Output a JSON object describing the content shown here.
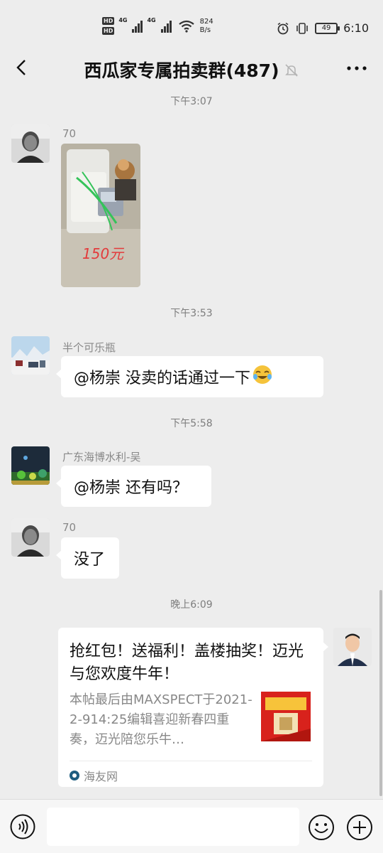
{
  "status_bar": {
    "hd1": "HD",
    "hd2": "HD",
    "sig1": "4G",
    "sig2": "4G",
    "net_speed_value": "824",
    "net_speed_unit": "B/s",
    "battery": "49",
    "time": "6:10"
  },
  "header": {
    "title": "西瓜家专属拍卖群(487)"
  },
  "messages": [
    {
      "timestamp": "下午3:07"
    },
    {
      "sender": "70"
    },
    {
      "image_label": "150元"
    },
    {
      "timestamp": "下午3:53"
    },
    {
      "sender": "半个可乐瓶",
      "text": "@杨崇  没卖的话通过一下"
    },
    {
      "timestamp": "下午5:58"
    },
    {
      "sender": "广东海博水利-吴",
      "text": "@杨崇  还有吗？"
    },
    {
      "sender": "70",
      "text": "没了"
    },
    {
      "timestamp": "晚上6:09"
    }
  ],
  "link_card": {
    "title": "抢红包！送福利！盖楼抽奖！迈光与您欢度牛年！",
    "description": "本帖最后由MAXSPECT于2021-2-914:25编辑喜迎新春四重奏，迈光陪您乐牛…",
    "source": "海友网"
  },
  "input_bar": {
    "placeholder": ""
  },
  "colors": {
    "background": "#ededed",
    "bubble": "#ffffff",
    "timestamp_text": "#7d7d7d"
  }
}
